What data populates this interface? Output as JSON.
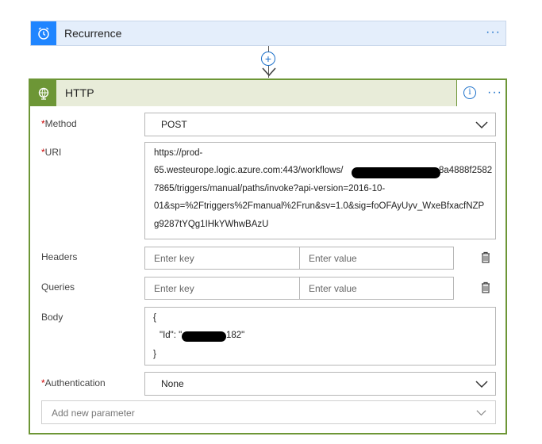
{
  "recurrence": {
    "title": "Recurrence",
    "more": "···"
  },
  "connector": {
    "add_symbol": "+"
  },
  "http": {
    "title": "HTTP",
    "info": "i",
    "more": "···",
    "method": {
      "label": "Method",
      "required": "*",
      "value": "POST"
    },
    "uri": {
      "label": "URI",
      "required": "*",
      "lines": [
        "https://prod-",
        "65.westeurope.logic.azure.com:443/workflows/",
        "8a4888f2582",
        "7865/triggers/manual/paths/invoke?api-version=2016-10-",
        "01&sp=%2Ftriggers%2Fmanual%2Frun&sv=1.0&sig=foOFAyUyv_WxeBfxacfNZP",
        "g9287tYQg1IHkYWhwBAzU"
      ]
    },
    "headers": {
      "label": "Headers",
      "key_placeholder": "Enter key",
      "value_placeholder": "Enter value"
    },
    "queries": {
      "label": "Queries",
      "key_placeholder": "Enter key",
      "value_placeholder": "Enter value"
    },
    "body": {
      "label": "Body",
      "open": "{",
      "key": "\"Id\": \"",
      "value_tail": "182\"",
      "close": "}"
    },
    "authentication": {
      "label": "Authentication",
      "required": "*",
      "value": "None"
    },
    "add_param": {
      "placeholder": "Add new parameter"
    }
  }
}
